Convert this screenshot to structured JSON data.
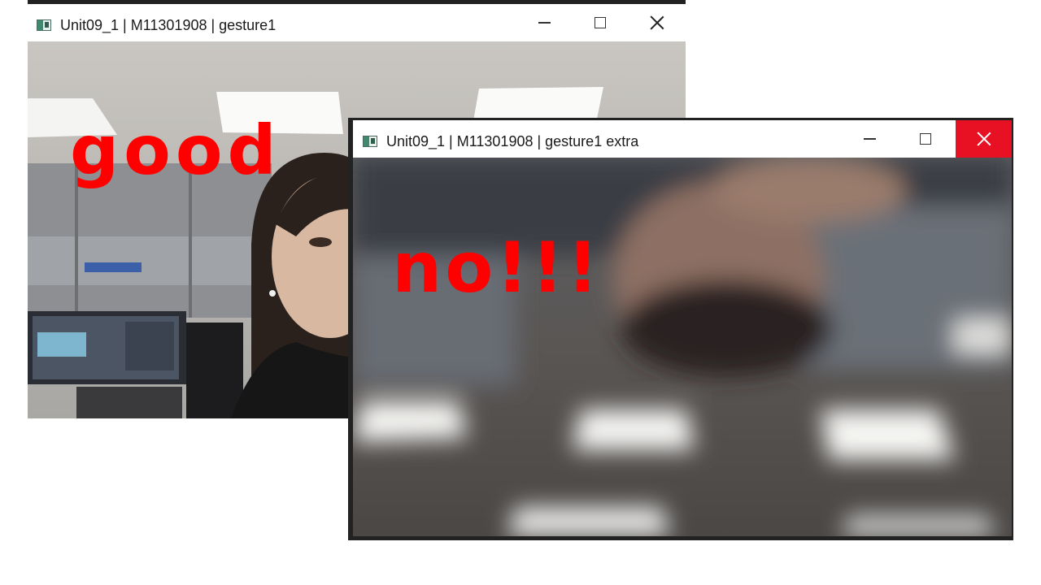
{
  "windows": [
    {
      "id": "main",
      "title": "Unit09_1 | M11301908 | gesture1",
      "overlay_text": "good",
      "active": false
    },
    {
      "id": "extra",
      "title": "Unit09_1 | M11301908 | gesture1 extra",
      "overlay_text": "no!!!",
      "active": true
    }
  ],
  "colors": {
    "overlay": "#ff0000",
    "close_active": "#e81123"
  }
}
